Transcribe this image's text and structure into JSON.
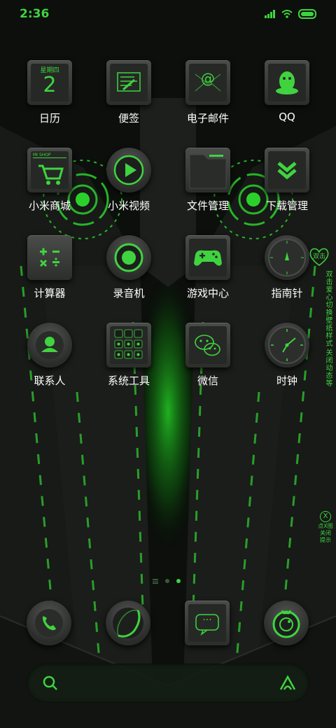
{
  "status": {
    "time": "2:36"
  },
  "colors": {
    "accent": "#3fd43f",
    "background": "#0c0f0c",
    "label": "#ffffff"
  },
  "apps": [
    {
      "label": "日历",
      "icon": "calendar-icon",
      "weekday": "星期四",
      "day": "2"
    },
    {
      "label": "便签",
      "icon": "notes-icon"
    },
    {
      "label": "电子邮件",
      "icon": "email-icon",
      "glyph": "@"
    },
    {
      "label": "QQ",
      "icon": "qq-icon"
    },
    {
      "label": "小米商城",
      "icon": "mi-store-icon",
      "tag": "MI SHOP"
    },
    {
      "label": "小米视频",
      "icon": "video-play-icon"
    },
    {
      "label": "文件管理",
      "icon": "folder-icon"
    },
    {
      "label": "下载管理",
      "icon": "download-icon"
    },
    {
      "label": "计算器",
      "icon": "calculator-icon"
    },
    {
      "label": "录音机",
      "icon": "recorder-icon"
    },
    {
      "label": "游戏中心",
      "icon": "gamepad-icon"
    },
    {
      "label": "指南针",
      "icon": "compass-icon"
    },
    {
      "label": "联系人",
      "icon": "contacts-icon"
    },
    {
      "label": "系统工具",
      "icon": "system-tools-icon"
    },
    {
      "label": "微信",
      "icon": "wechat-icon"
    },
    {
      "label": "时钟",
      "icon": "clock-icon"
    }
  ],
  "side_hints": {
    "heart_label": "双击",
    "wallpaper_hint_1": "双击爱心切换壁纸样式",
    "wallpaper_hint_2": "关闭动态等",
    "close_glyph": "X",
    "close_hint_line1": "点X图",
    "close_hint_line2": "关闭",
    "close_hint_line3": "提示"
  },
  "pager": {
    "pages": 2,
    "active": 2
  },
  "dock": [
    {
      "name": "phone",
      "icon": "phone-icon"
    },
    {
      "name": "browser",
      "icon": "browser-icon"
    },
    {
      "name": "messages",
      "icon": "message-icon",
      "glyph": "···"
    },
    {
      "name": "camera",
      "icon": "camera-icon"
    }
  ],
  "search": {
    "left_icon": "search-icon",
    "right_icon": "assistant-icon"
  }
}
